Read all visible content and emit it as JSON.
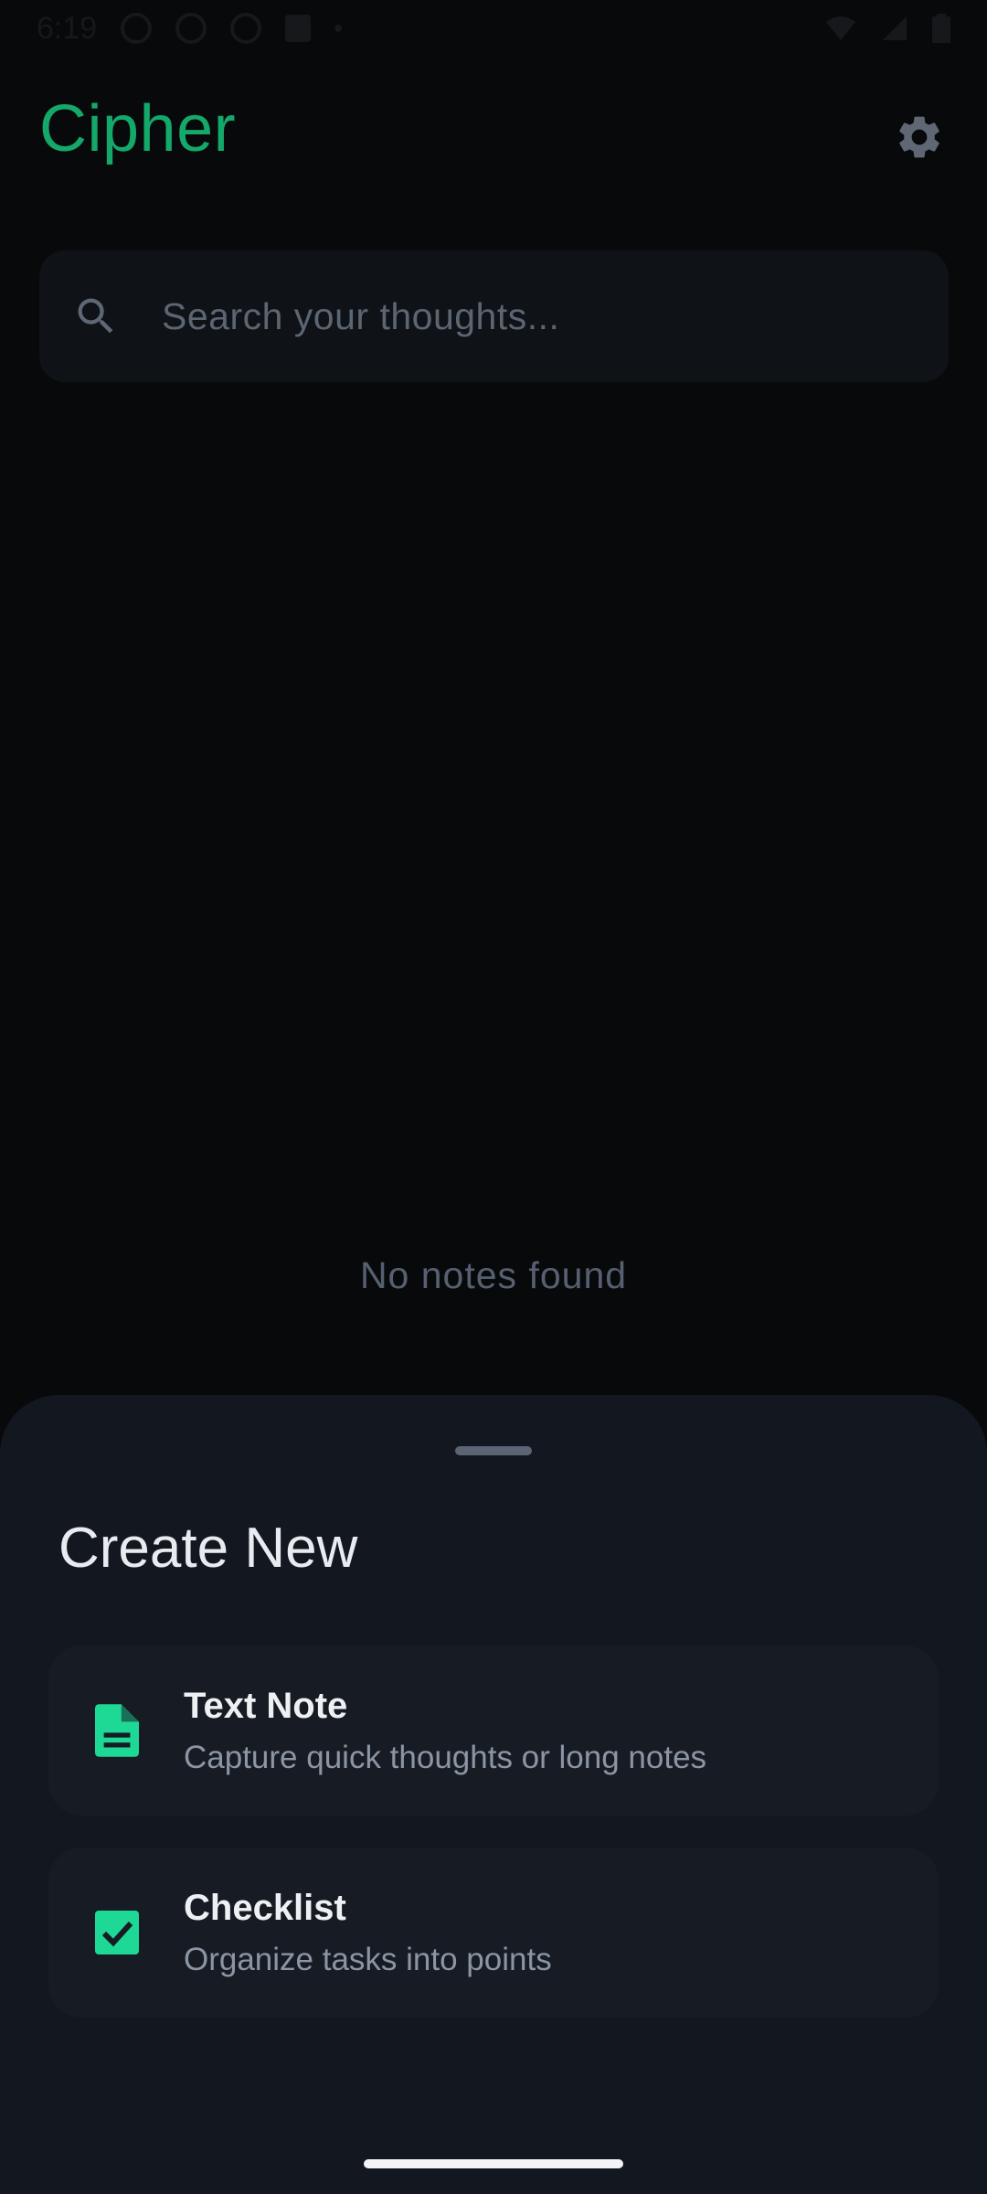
{
  "status_bar": {
    "time": "6:19"
  },
  "header": {
    "title": "Cipher",
    "settings_icon": "gear-icon"
  },
  "search": {
    "placeholder": "Search your thoughts...",
    "icon": "search-icon"
  },
  "empty_state": {
    "message": "No notes found"
  },
  "sheet": {
    "title": "Create New",
    "options": [
      {
        "title": "Text Note",
        "subtitle": "Capture quick thoughts or long notes",
        "icon": "document-icon"
      },
      {
        "title": "Checklist",
        "subtitle": "Organize tasks into points",
        "icon": "checkbox-icon"
      }
    ]
  },
  "colors": {
    "accent": "#14a86a",
    "icon_accent": "#1ed895",
    "background": "#08090b",
    "sheet_background": "#131820",
    "card_background": "#171c24"
  }
}
